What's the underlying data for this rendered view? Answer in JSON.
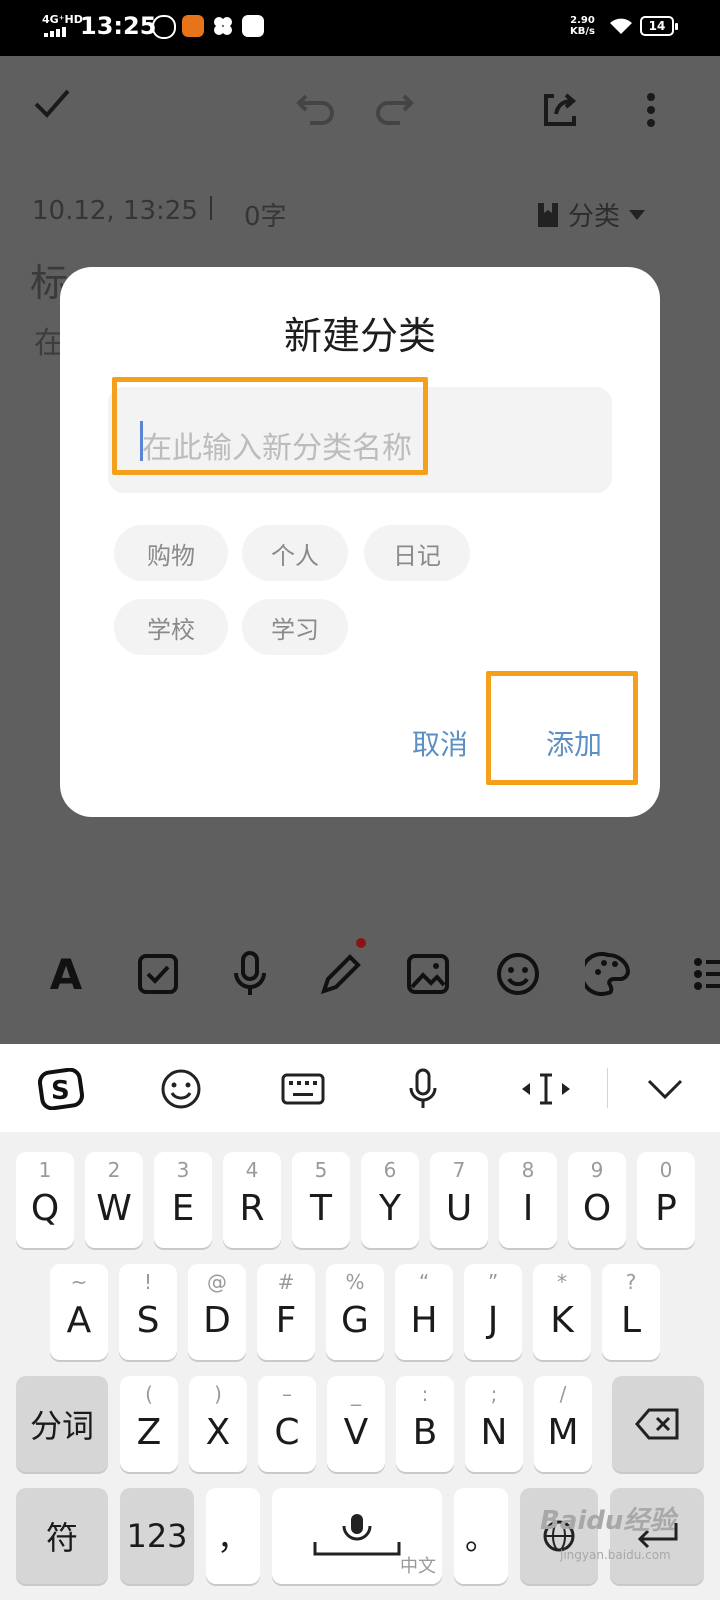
{
  "status_bar": {
    "network": "4G⁺HD",
    "time": "13:25",
    "speed_value": "2.90",
    "speed_unit": "KB/s",
    "battery": "14"
  },
  "editor": {
    "date": "10.12, 13:25",
    "word_count": "0字",
    "category_label": "分类",
    "title_placeholder": "标",
    "body_placeholder": "在"
  },
  "dialog": {
    "title": "新建分类",
    "input_placeholder": "在此输入新分类名称",
    "chips": [
      "购物",
      "个人",
      "日记",
      "学校",
      "学习"
    ],
    "cancel_label": "取消",
    "add_label": "添加"
  },
  "keyboard": {
    "row1": [
      {
        "sub": "1",
        "main": "Q"
      },
      {
        "sub": "2",
        "main": "W"
      },
      {
        "sub": "3",
        "main": "E"
      },
      {
        "sub": "4",
        "main": "R"
      },
      {
        "sub": "5",
        "main": "T"
      },
      {
        "sub": "6",
        "main": "Y"
      },
      {
        "sub": "7",
        "main": "U"
      },
      {
        "sub": "8",
        "main": "I"
      },
      {
        "sub": "9",
        "main": "O"
      },
      {
        "sub": "0",
        "main": "P"
      }
    ],
    "row2": [
      {
        "sub": "~",
        "main": "A"
      },
      {
        "sub": "!",
        "main": "S"
      },
      {
        "sub": "@",
        "main": "D"
      },
      {
        "sub": "#",
        "main": "F"
      },
      {
        "sub": "%",
        "main": "G"
      },
      {
        "sub": "“",
        "main": "H"
      },
      {
        "sub": "”",
        "main": "J"
      },
      {
        "sub": "*",
        "main": "K"
      },
      {
        "sub": "?",
        "main": "L"
      }
    ],
    "row3": [
      {
        "sub": "(",
        "main": "Z"
      },
      {
        "sub": ")",
        "main": "X"
      },
      {
        "sub": "–",
        "main": "C"
      },
      {
        "sub": "_",
        "main": "V"
      },
      {
        "sub": ":",
        "main": "B"
      },
      {
        "sub": ";",
        "main": "N"
      },
      {
        "sub": "/",
        "main": "M"
      }
    ],
    "segment_key": "分词",
    "symbol_key": "符",
    "number_key": "123",
    "comma_key": "，",
    "period_key": "。",
    "space_label": "中文"
  },
  "watermark": {
    "brand": "Baidu经验",
    "url": "jingyan.baidu.com"
  },
  "colors": {
    "highlight": "#f5a01a",
    "accent_button": "#5c8fc6",
    "dim_overlay": "#5f5f5f"
  }
}
